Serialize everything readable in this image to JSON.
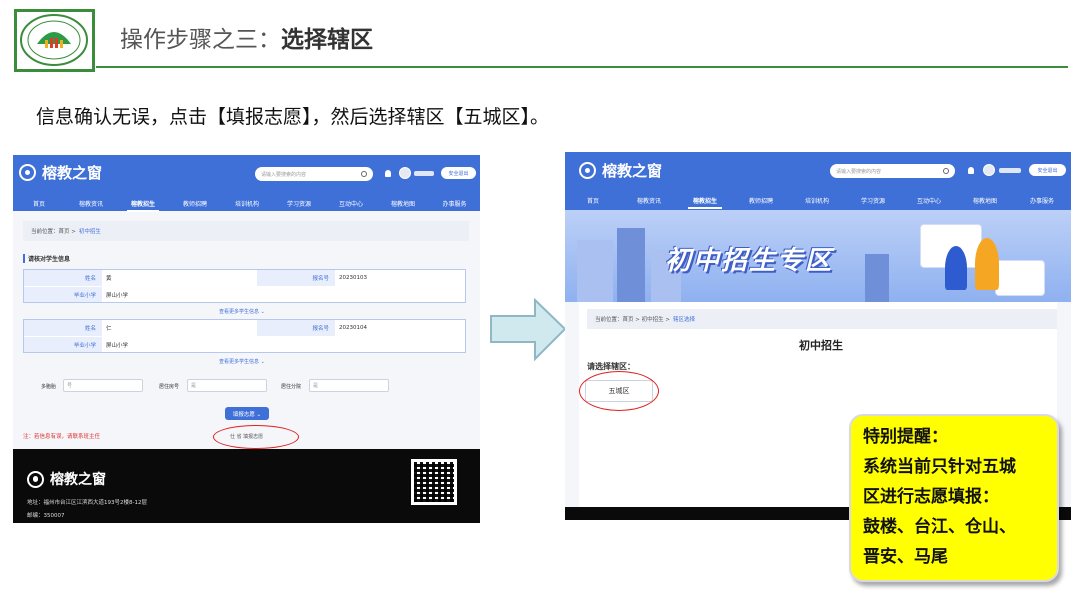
{
  "slide": {
    "title_prefix": "操作步骤之三：",
    "title_bold": "选择辖区",
    "instruction": "信息确认无误，点击【填报志愿】，然后选择辖区【五城区】。"
  },
  "site": {
    "brand": "榕教之窗",
    "search_placeholder": "请输入要搜索的内容",
    "logout": "安全退出",
    "nav": [
      "首页",
      "榕教资讯",
      "榕教招生",
      "教师招聘",
      "培训机构",
      "学习资源",
      "互动中心",
      "榕教地图",
      "办事服务"
    ]
  },
  "left": {
    "crumb_prefix": "当前位置：首页 >",
    "crumb_current": "初中招生",
    "section_title": "请核对学生信息",
    "students": [
      {
        "name_label": "姓名",
        "name_value": "黄",
        "id_label": "报名号",
        "id_value": "20230103",
        "school_label": "毕业小学",
        "school_value": "屏山小学"
      },
      {
        "name_label": "姓名",
        "name_value": "仁",
        "id_label": "报名号",
        "id_value": "20230104",
        "school_label": "毕业小学",
        "school_value": "屏山小学"
      }
    ],
    "more_info": "查看更多学生信息 ⌄",
    "fields": [
      {
        "label": "多胞胎",
        "value": "号"
      },
      {
        "label": "居住房号",
        "value": "是"
      },
      {
        "label": "居住分院",
        "value": "是"
      }
    ],
    "submit": "填报志愿 ⌄",
    "note": "注：若信息有误，请联系班主任",
    "blur_text": "仕    省    填报志愿",
    "footer_brand": "榕教之窗",
    "footer_addr": "地址：福州市台江区江滨西大道193号2楼8-12层",
    "footer_postcode": "邮编：350007"
  },
  "right": {
    "banner_text": "初中招生专区",
    "crumb_prefix": "当前位置：首页 > 初中招生 >",
    "crumb_current": "辖区选择",
    "content_title": "初中招生",
    "pick_label": "请选择辖区：",
    "district": "五城区"
  },
  "callout": {
    "line1": "特别提醒：",
    "line2": "系统当前只针对五城",
    "line3": "区进行志愿填报：",
    "line4": "鼓楼、台江、仓山、",
    "line5": "晋安、马尾"
  },
  "colors": {
    "accent": "#3f70d8",
    "slide_green": "#3a8d3a",
    "callout_yellow": "#ffff00",
    "highlight_red": "#e02020"
  }
}
